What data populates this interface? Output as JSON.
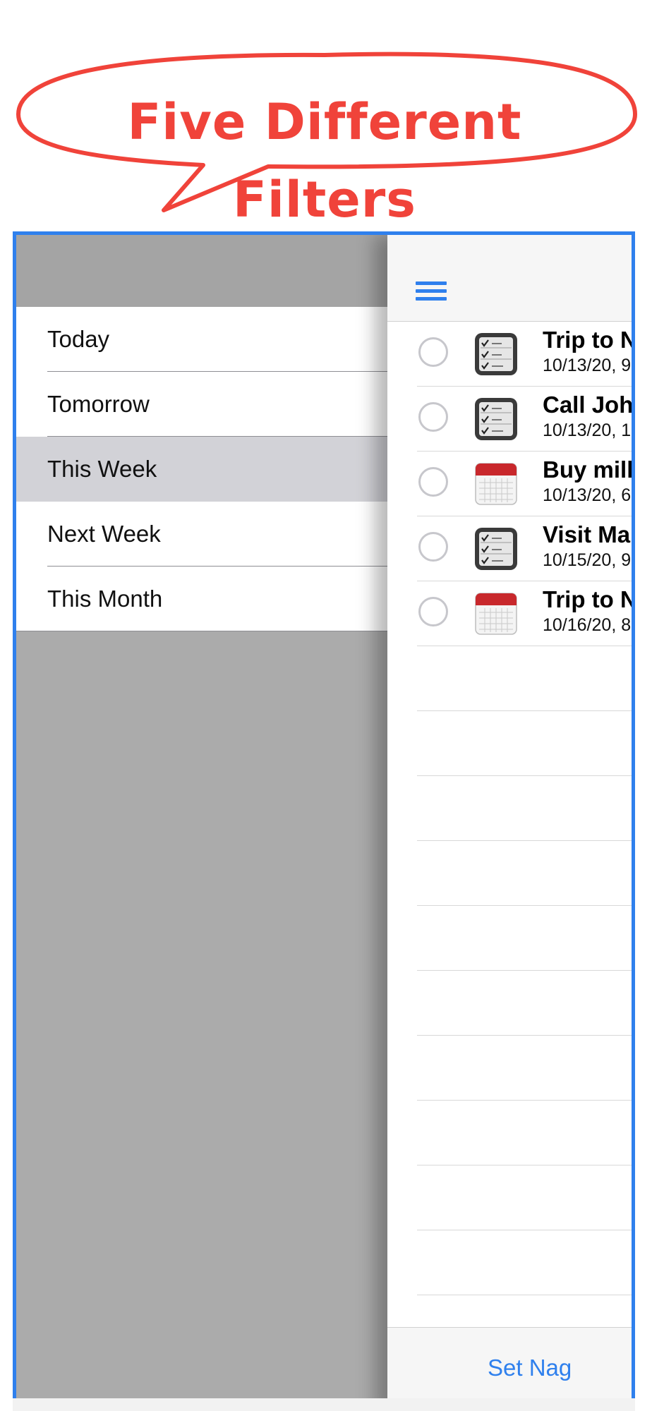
{
  "banner": {
    "headline": "Five Different Filters",
    "color": "#f0433a"
  },
  "sidebar": {
    "filters": [
      {
        "label": "Today",
        "selected": false
      },
      {
        "label": "Tomorrow",
        "selected": false
      },
      {
        "label": "This Week",
        "selected": true
      },
      {
        "label": "Next Week",
        "selected": false
      },
      {
        "label": "This Month",
        "selected": false
      }
    ]
  },
  "main": {
    "tasks": [
      {
        "title": "Trip to N",
        "date": "10/13/20, 9",
        "icon": "checklist-icon"
      },
      {
        "title": "Call Joh",
        "date": "10/13/20, 1",
        "icon": "checklist-icon"
      },
      {
        "title": "Buy mill",
        "date": "10/13/20, 6",
        "icon": "calendar-icon"
      },
      {
        "title": "Visit Ma",
        "date": "10/15/20, 9",
        "icon": "checklist-icon"
      },
      {
        "title": "Trip to N",
        "date": "10/16/20, 8",
        "icon": "calendar-icon"
      }
    ],
    "toolbar": {
      "set_nag_label": "Set Nag"
    }
  },
  "colors": {
    "accent": "#2f80ed",
    "selected_row": "#d2d2d7",
    "sidebar_bg": "#ababab"
  }
}
